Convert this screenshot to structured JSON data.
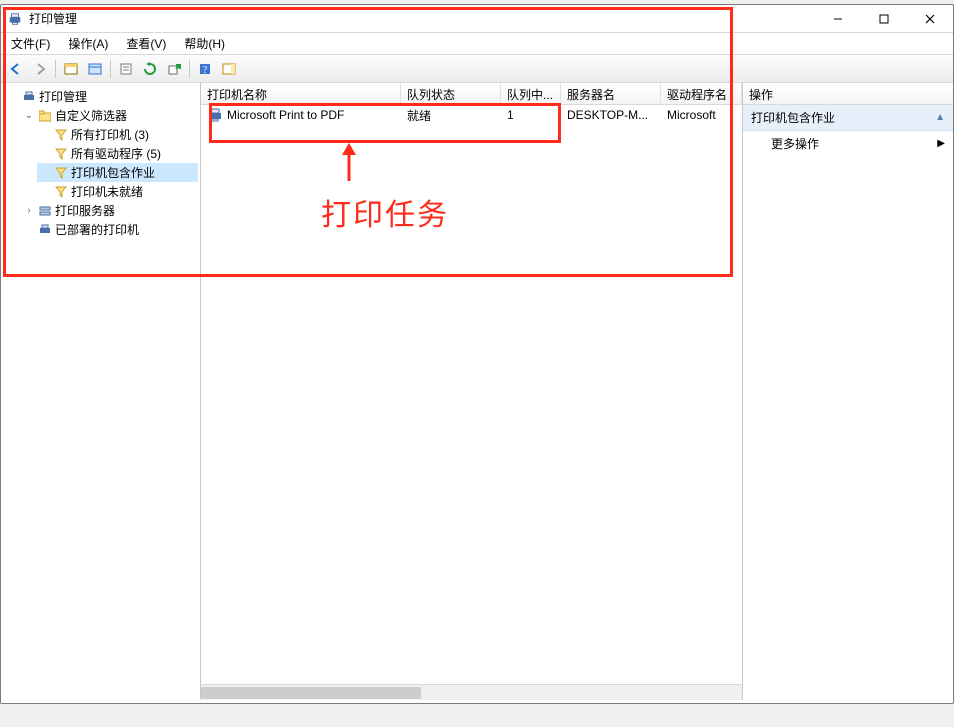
{
  "window": {
    "title": "打印管理"
  },
  "menu": {
    "file": "文件(F)",
    "action": "操作(A)",
    "view": "查看(V)",
    "help": "帮助(H)"
  },
  "tree": {
    "root": "打印管理",
    "custom_filters": "自定义筛选器",
    "all_printers": "所有打印机 (3)",
    "all_drivers": "所有驱动程序 (5)",
    "printers_with_jobs": "打印机包含作业",
    "printers_not_ready": "打印机未就绪",
    "print_servers": "打印服务器",
    "deployed_printers": "已部署的打印机"
  },
  "columns": {
    "printer_name": "打印机名称",
    "queue_status": "队列状态",
    "jobs_in_queue": "队列中...",
    "server_name": "服务器名",
    "driver_name": "驱动程序名"
  },
  "rows": [
    {
      "name": "Microsoft Print to PDF",
      "status": "就绪",
      "jobs": "1",
      "server": "DESKTOP-M...",
      "driver": "Microsoft"
    }
  ],
  "actions": {
    "header": "操作",
    "group1": "打印机包含作业",
    "more_actions": "更多操作"
  },
  "annotation": {
    "label": "打印任务"
  }
}
